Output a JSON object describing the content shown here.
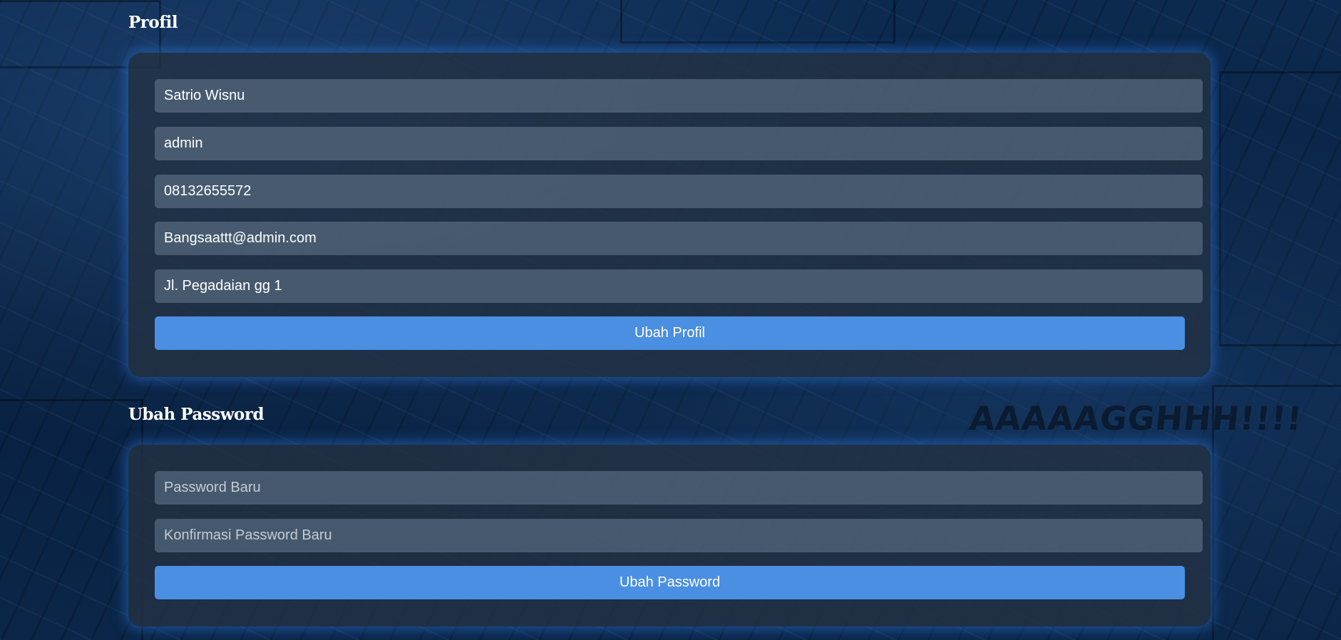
{
  "profile": {
    "title": "Profil",
    "name": "Satrio Wisnu",
    "username": "admin",
    "phone": "08132655572",
    "email": "Bangsaattt@admin.com",
    "address": "Jl. Pegadaian gg 1",
    "submit_label": "Ubah Profil"
  },
  "password": {
    "title": "Ubah Password",
    "new_placeholder": "Password Baru",
    "confirm_placeholder": "Konfirmasi Password Baru",
    "submit_label": "Ubah Password"
  },
  "background": {
    "comic_text": "AAAAAGGHHH!!!!"
  },
  "colors": {
    "accent": "#4a8fe2",
    "glow": "#2d78dc",
    "card": "#233244",
    "field": "#5f7387"
  }
}
